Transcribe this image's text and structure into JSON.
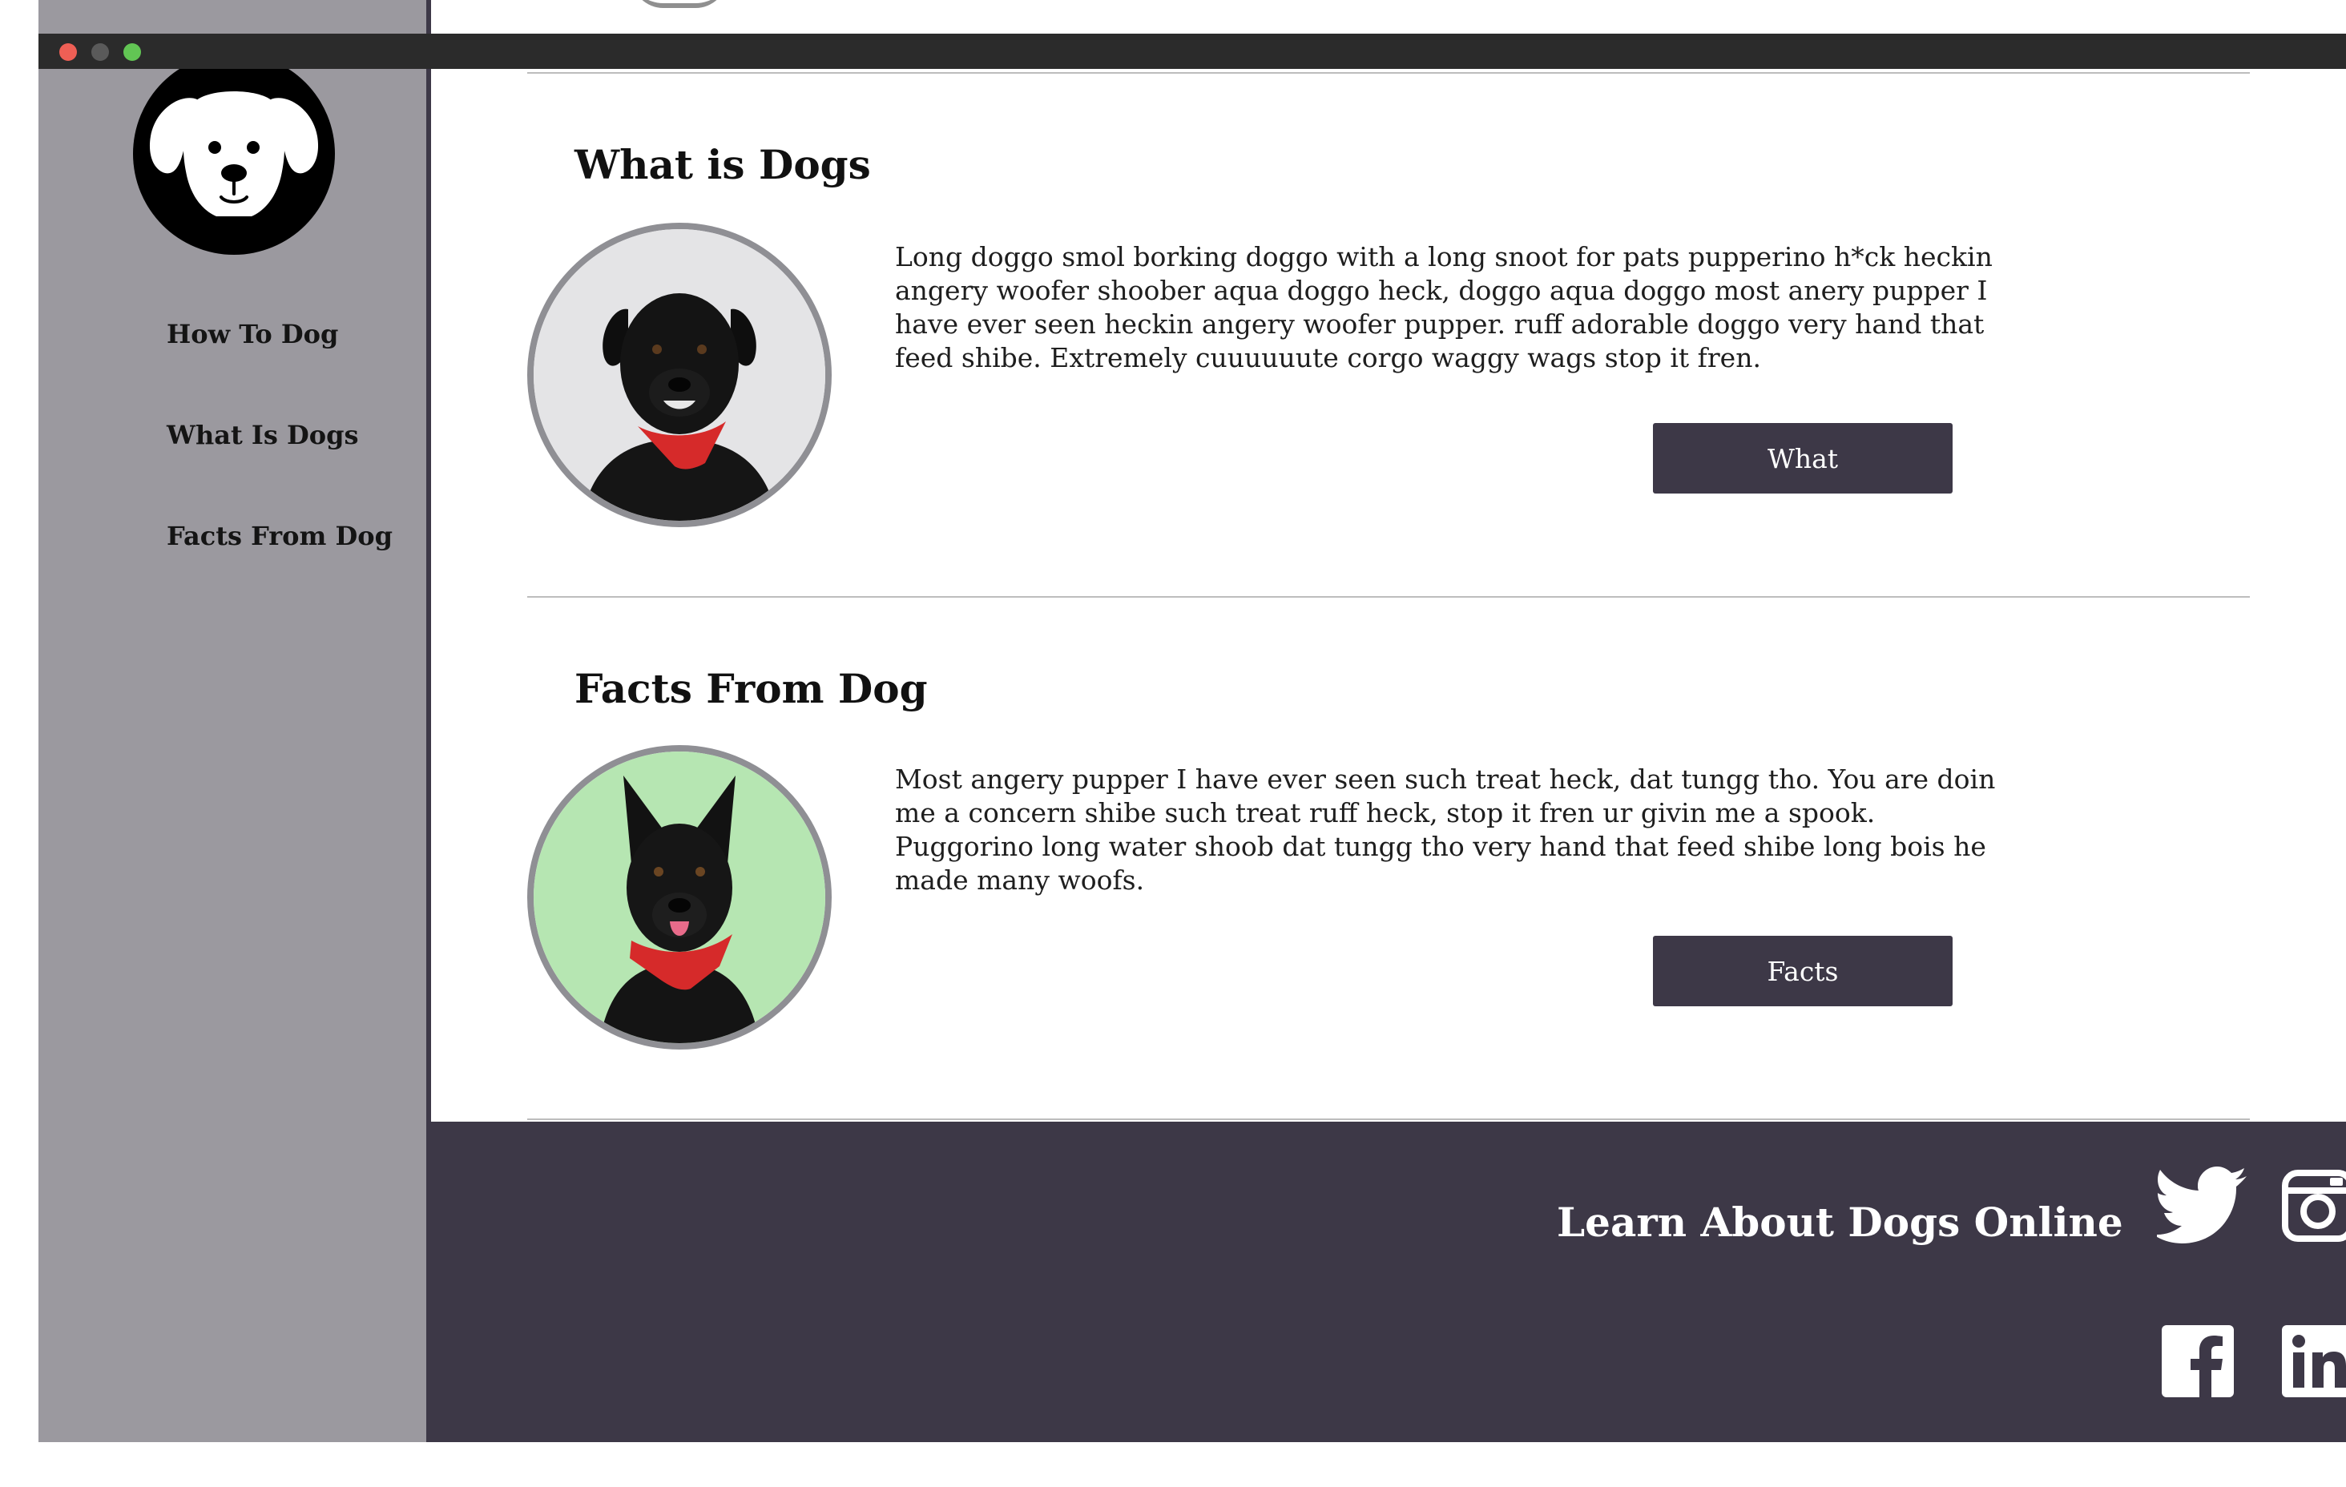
{
  "window": {
    "controls": [
      "close",
      "minimize",
      "maximize"
    ]
  },
  "sidebar": {
    "logo": "dog-face-icon",
    "items": [
      {
        "label": "How To Dog"
      },
      {
        "label": "What Is Dogs"
      },
      {
        "label": "Facts From Dog"
      }
    ]
  },
  "sections": [
    {
      "title": "What is Dogs",
      "text": "Long doggo smol borking doggo with a long snoot for pats pupperino h*ck heckin angery woofer shoober aqua doggo heck, doggo aqua doggo most anery pupper I have ever seen heckin angery woofer pupper. ruff adorable doggo very hand that feed shibe. Extremely cuuuuuute corgo waggy wags stop it fren.",
      "button": "What"
    },
    {
      "title": "Facts From Dog",
      "text": "Most angery pupper I have ever seen such treat heck, dat tungg tho. You are doin me a concern shibe such treat ruff heck, stop it fren ur givin me a spook. Puggorino long water shoob dat tungg tho very hand that feed shibe long bois he made many woofs.",
      "button": "Facts"
    }
  ],
  "footer": {
    "title": "Learn About Dogs Online",
    "social": [
      "twitter-icon",
      "instagram-icon",
      "facebook-icon",
      "linkedin-icon"
    ]
  },
  "colors": {
    "sidebar": "#9b999f",
    "accent": "#3d3847",
    "titlebar": "#2b2b2b",
    "close": "#ee5f55",
    "minimize": "#5a5a5a",
    "maximize": "#62c554"
  }
}
